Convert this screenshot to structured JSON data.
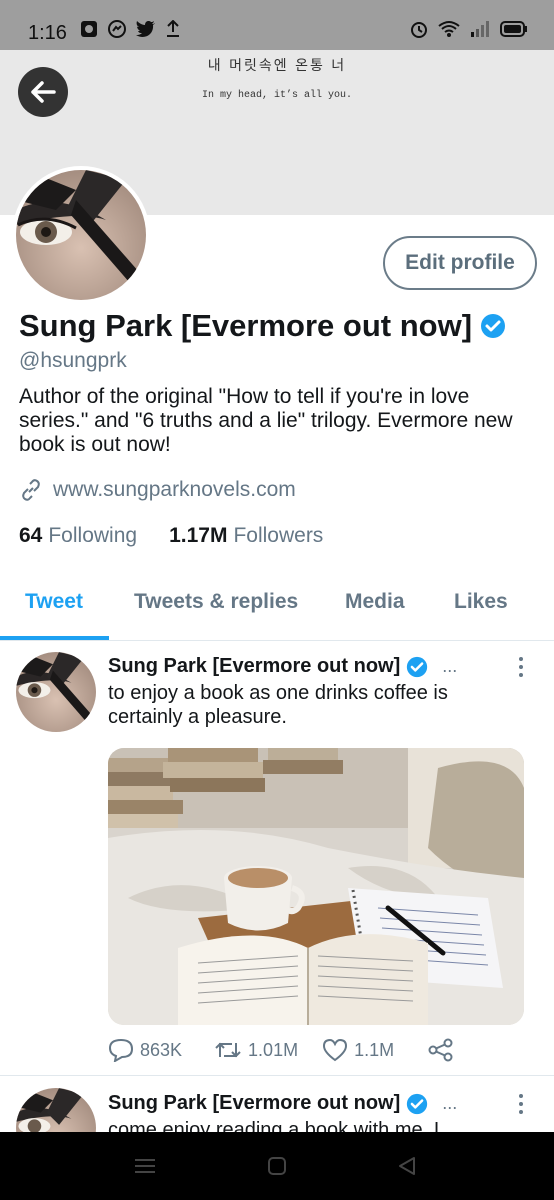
{
  "status_bar": {
    "time": "1:16"
  },
  "banner": {
    "korean_text": "내 머릿속엔 온통 너",
    "english_text": "In my head, it’s all you."
  },
  "profile": {
    "name": "Sung Park [Evermore out now]",
    "handle": "@hsungprk",
    "bio": "Author of the original \"How to tell if you're in love series.\" and \"6 truths and a lie\" trilogy. Evermore new book is out now!",
    "website": "www.sungparknovels.com",
    "following_count": "64",
    "following_label": "Following",
    "followers_count": "1.17M",
    "followers_label": "Followers",
    "edit_label": "Edit profile"
  },
  "tabs": [
    "Tweet",
    "Tweets & replies",
    "Media",
    "Likes"
  ],
  "active_tab": "Tweet",
  "tweets": [
    {
      "name": "Sung Park [Evermore out now]",
      "ellipsis": "...",
      "text": "to enjoy a book as one drinks coffee is certainly a pleasure.",
      "replies": "863K",
      "retweets": "1.01M",
      "likes": "1.1M"
    },
    {
      "name": "Sung Park [Evermore out now]",
      "ellipsis": "...",
      "text": "come enjoy reading a book with me. I"
    }
  ],
  "colors": {
    "accent": "#1da1f2",
    "secondary_text": "#657786",
    "verified": "#1da1f2"
  }
}
